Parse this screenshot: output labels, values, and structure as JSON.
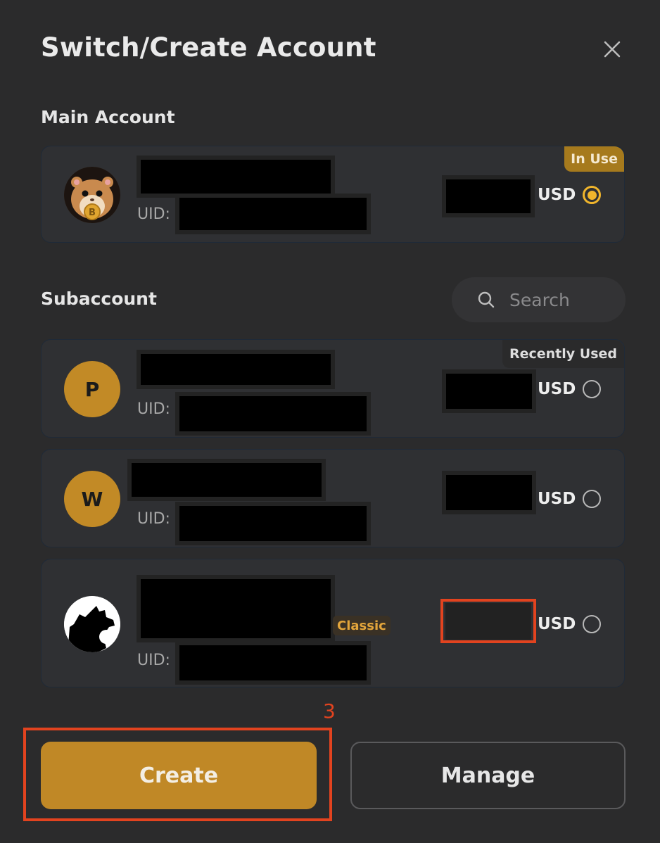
{
  "dialog": {
    "title": "Switch/Create Account"
  },
  "main_section": {
    "label": "Main Account"
  },
  "main_account": {
    "uid_label": "UID:",
    "currency": "USD",
    "badge": "In Use",
    "selected": true
  },
  "sub_section": {
    "label": "Subaccount",
    "search_placeholder": "Search"
  },
  "subaccounts": [
    {
      "initial": "P",
      "uid_label": "UID:",
      "currency": "USD",
      "badge": "Recently Used",
      "selected": false
    },
    {
      "initial": "W",
      "uid_label": "UID:",
      "currency": "USD",
      "selected": false
    },
    {
      "uid_label": "UID:",
      "currency": "USD",
      "badge": "Classic",
      "selected": false
    }
  ],
  "actions": {
    "create_label": "Create",
    "manage_label": "Manage"
  },
  "annotation": {
    "step_number": "3"
  },
  "colors": {
    "accent": "#c08826",
    "radio_active": "#f0b52c",
    "annotation": "#e2431f",
    "background": "#2b2b2c"
  },
  "icons": {
    "close": "close-icon",
    "search": "search-icon"
  }
}
